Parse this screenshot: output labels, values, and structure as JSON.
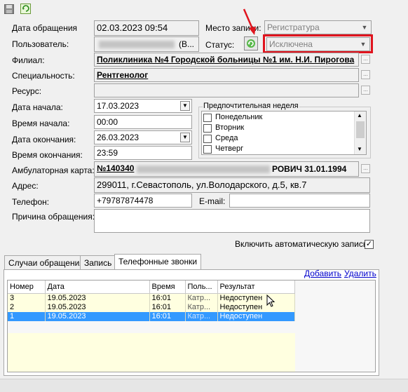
{
  "toolbar": {
    "save_icon": "floppy-icon",
    "refresh_icon": "refresh-icon"
  },
  "form": {
    "date_label": "Дата обращения",
    "date_value": "02.03.2023 09:54",
    "place_label": "Место записи:",
    "place_value": "Регистратура",
    "user_label": "Пользователь:",
    "user_value": "(В...",
    "status_label": "Статус:",
    "status_value": "Исключена",
    "branch_label": "Филиал:",
    "branch_value": "Поликлиника №4 Городской больницы №1 им. Н.И. Пирогова",
    "specialty_label": "Специальность:",
    "specialty_value": "Рентгенолог",
    "resource_label": "Ресурс:",
    "resource_value": "",
    "start_date_label": "Дата начала:",
    "start_date_value": "17.03.2023",
    "start_time_label": "Время начала:",
    "start_time_value": "00:00",
    "end_date_label": "Дата окончания:",
    "end_date_value": "26.03.2023",
    "end_time_label": "Время окончания:",
    "end_time_value": "23:59",
    "card_label": "Амбулаторная карта:",
    "card_value_start": "№140340",
    "card_value_end": "РОВИЧ 31.01.1994",
    "address_label": "Адрес:",
    "address_value": "299011, г.Севастополь, ул.Володарского, д.5, кв.7",
    "phone_label": "Телефон:",
    "phone_value": "+79787874478",
    "email_label": "E-mail:",
    "email_value": "",
    "reason_label": "Причина обращения:",
    "reason_value": "",
    "auto_label": "Включить автоматическую запись",
    "auto_checked": true
  },
  "week": {
    "title": "Предпочтительная неделя",
    "days": [
      "Понедельник",
      "Вторник",
      "Среда",
      "Четверг"
    ]
  },
  "tabs": [
    "Случаи обращения",
    "Запись",
    "Телефонные звонки"
  ],
  "calls": {
    "add_label": "Добавить",
    "delete_label": "Удалить",
    "columns": [
      "Номер",
      "Дата",
      "Время",
      "Поль...",
      "Результат"
    ],
    "rows": [
      {
        "num": "3",
        "date": "19.05.2023",
        "time": "16:01",
        "user": "Катр...",
        "result": "Недоступен",
        "selected": false
      },
      {
        "num": "2",
        "date": "19.05.2023",
        "time": "16:01",
        "user": "Катр...",
        "result": "Недоступен",
        "selected": false
      },
      {
        "num": "1",
        "date": "19.05.2023",
        "time": "16:01",
        "user": "Катр...",
        "result": "Недоступен",
        "selected": true
      }
    ]
  },
  "colors": {
    "annotation_red": "#e0141e",
    "selection": "#3399ff",
    "grid_row": "#ffffe0"
  }
}
